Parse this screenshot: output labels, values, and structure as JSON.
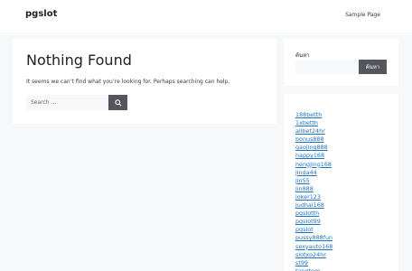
{
  "header": {
    "site_title": "pgslot",
    "nav_link": "Sample Page"
  },
  "main": {
    "title": "Nothing Found",
    "message": "It seems we can’t find what you’re looking for. Perhaps searching can help.",
    "search_placeholder": "Search …",
    "search_icon": "search-icon"
  },
  "sidebar": {
    "search_label": "ค้นหา",
    "search_button": "ค้นหา",
    "links": [
      "188betth",
      "1xbetth",
      "allbet24hr",
      "bonus888",
      "gaojing888",
      "happy168",
      "hengjing168",
      "jinda44",
      "jin55",
      "jin888",
      "joker123",
      "judhai168",
      "pgslotth",
      "pgslot99",
      "pgslot",
      "pussy888fun",
      "sexyauto168",
      "slotxo24hr",
      "st99",
      "tangtem"
    ]
  },
  "colors": {
    "background": "#f7f8f9",
    "card": "#ffffff",
    "button": "#55555e",
    "link": "#1e73be"
  }
}
